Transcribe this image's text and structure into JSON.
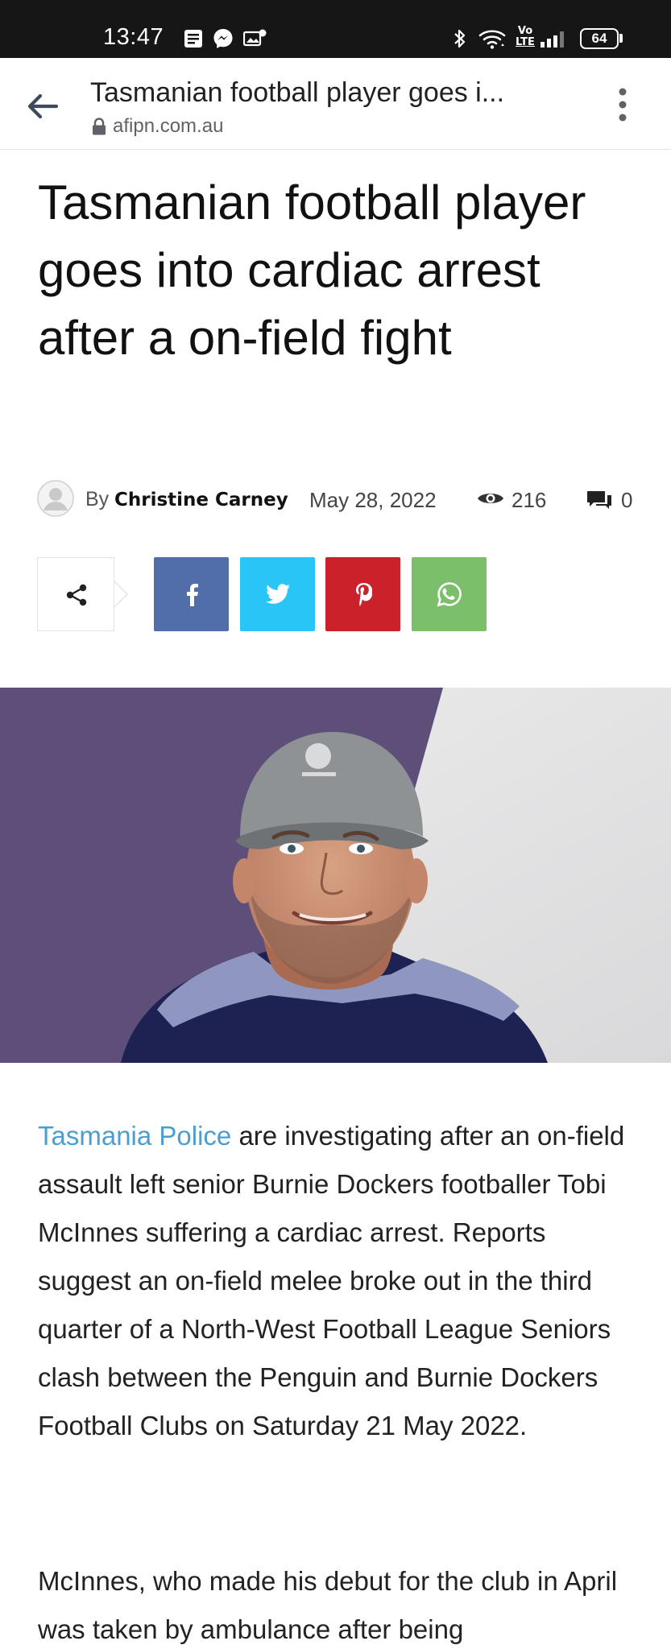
{
  "status_bar": {
    "time": "13:47",
    "battery": "64",
    "icons": [
      "notes-icon",
      "messenger-icon",
      "photo-notification-icon",
      "bluetooth-icon",
      "wifi-icon",
      "volte-icon",
      "signal-icon",
      "battery-icon"
    ],
    "volte_label_top": "Vo",
    "volte_label_bottom": "LTE"
  },
  "browser": {
    "tab_title": "Tasmanian football player goes i...",
    "url": "afipn.com.au"
  },
  "article": {
    "title": "Tasmanian football player goes into cardiac arrest after a on-field fight",
    "meta": {
      "by": "By",
      "author": "Christine Carney",
      "date": "May 28, 2022",
      "views": "216",
      "comments": "0"
    },
    "share": {
      "buttons": [
        "share-icon",
        "facebook-icon",
        "twitter-icon",
        "pinterest-icon",
        "whatsapp-icon"
      ],
      "colors": {
        "facebook": "#516eab",
        "twitter": "#29c5f6",
        "pinterest": "#ca212a",
        "whatsapp": "#7bbf6a"
      }
    },
    "body": {
      "p1_link": "Tasmania Police",
      "p1_rest": " are investigating after an on-field assault left senior Burnie Dockers footballer Tobi McInnes suffering a cardiac arrest. Reports suggest an on-field melee broke out in the third quarter of a North-West Football League Seniors clash between the Penguin and Burnie Dockers Football Clubs on Saturday 21 May 2022.",
      "p2": "McInnes, who made his debut for the club in April was taken by ambulance after being"
    },
    "link_color": "#4a9fd0"
  }
}
